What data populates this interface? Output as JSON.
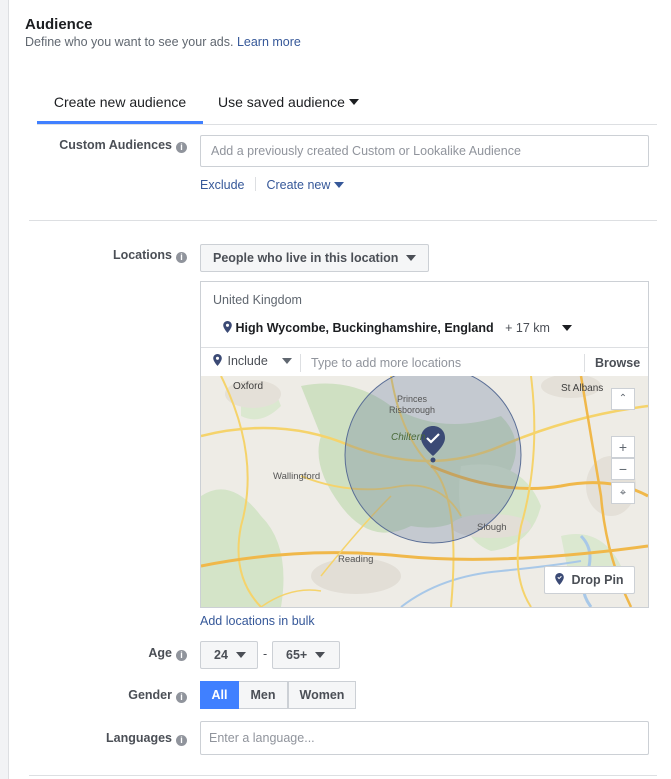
{
  "header": {
    "title": "Audience",
    "subtitle": "Define who you want to see your ads.",
    "learn_more": "Learn more"
  },
  "tabs": {
    "create": "Create new audience",
    "saved": "Use saved audience"
  },
  "custom_audiences": {
    "label": "Custom Audiences",
    "placeholder": "Add a previously created Custom or Lookalike Audience",
    "exclude": "Exclude",
    "create_new": "Create new"
  },
  "locations": {
    "label": "Locations",
    "mode": "People who live in this location",
    "country": "United Kingdom",
    "place": "High Wycombe, Buckinghamshire, England",
    "radius": "+ 17 km",
    "include": "Include",
    "search_placeholder": "Type to add more locations",
    "browse": "Browse",
    "drop_pin": "Drop Pin",
    "bulk": "Add locations in bulk",
    "map_labels": {
      "oxford": "Oxford",
      "st_albans": "St Albans",
      "princes": "Princes",
      "risborough": "Risborough",
      "chiltern": "Chiltern",
      "wallingford": "Wallingford",
      "slough": "Slough",
      "reading": "Reading"
    },
    "zoom_in": "+",
    "zoom_out": "−"
  },
  "age": {
    "label": "Age",
    "min": "24",
    "separator": "-",
    "max": "65+"
  },
  "gender": {
    "label": "Gender",
    "options": [
      "All",
      "Men",
      "Women"
    ],
    "selected": "All"
  },
  "languages": {
    "label": "Languages",
    "placeholder": "Enter a language..."
  },
  "colors": {
    "accent": "#4080ff",
    "link": "#365899",
    "pin": "#3b4a75"
  }
}
